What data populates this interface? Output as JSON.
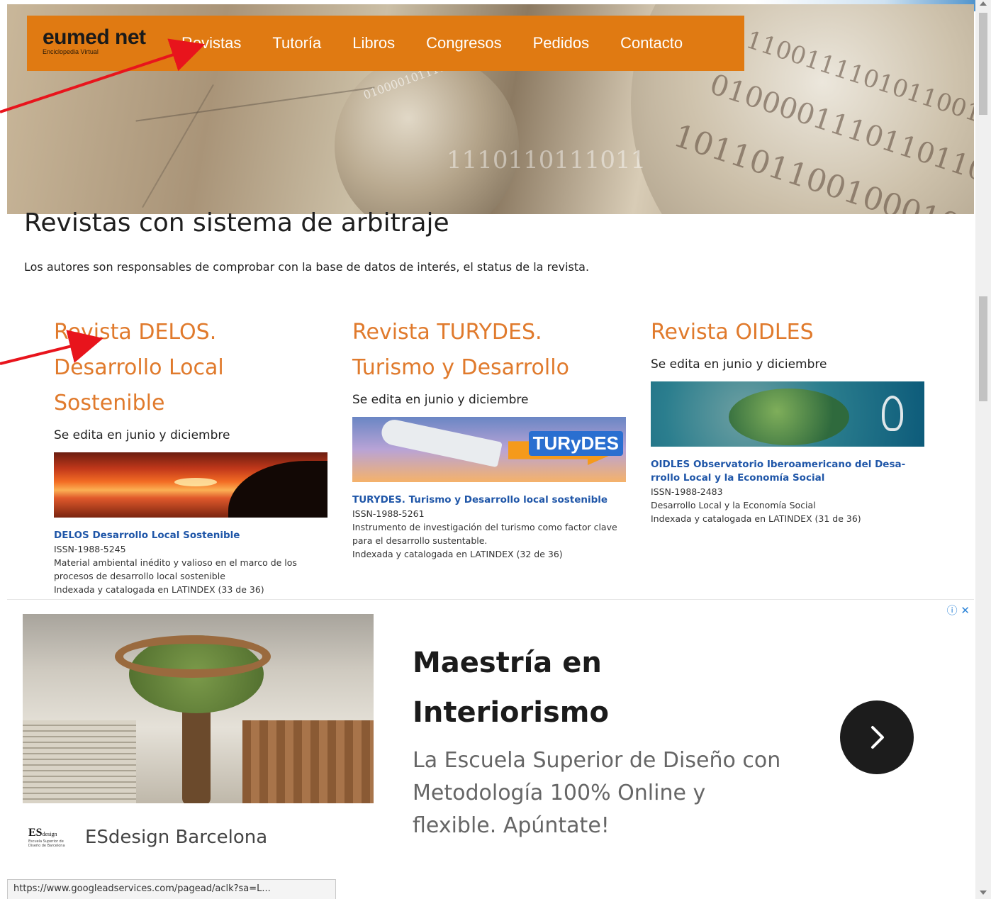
{
  "nav": {
    "logo_brand": "eumed net",
    "logo_tagline": "Enciclopedia Virtual",
    "items": [
      "Revistas",
      "Tutoría",
      "Libros",
      "Congresos",
      "Pedidos",
      "Contacto"
    ]
  },
  "main": {
    "title": "Revistas con sistema de arbitraje",
    "intro": "Los autores son responsables de comprobar con la base de datos de interés, el status de la revista.",
    "journals": [
      {
        "title": "Revista DELOS. Desarrollo Local Sostenible",
        "edition": "Se edita en junio y diciembre",
        "info_title": "DELOS Desarrollo Local Sostenible",
        "issn": "ISSN-1988-5245",
        "desc": "Material ambiental inédito y valioso en el marco de los procesos de desarrollo local sostenible",
        "index": "Indexada y catalogada en LATINDEX (33 de 36)"
      },
      {
        "title": "Revista TURYDES. Turismo y Desarrollo",
        "edition": "Se edita en junio y diciembre",
        "cover_brand": "TURyDES",
        "info_title": "TURYDES. Turismo y Desarrollo local sostenible",
        "issn": "ISSN-1988-5261",
        "desc": "Instrumento de investigación del turismo como factor clave para el desarrollo sustentable.",
        "index": "Indexada y catalogada en LATINDEX (32 de 36)"
      },
      {
        "title": "Revista OIDLES",
        "edition": "Se edita en junio y diciembre",
        "info_title": "OIDLES Observatorio Iberoamericano del Desa-rrollo Local y la Economía Social",
        "issn": "ISSN-1988-2483",
        "desc": "Desarrollo Local y la Economía Social",
        "index": "Indexada y catalogada en LATINDEX (31 de 36)"
      }
    ]
  },
  "ad": {
    "close_label": "ⓘ ✕",
    "logo_text": "ES",
    "logo_small": "design",
    "logo_sub": "Escuela Superior de Diseño de Barcelona",
    "advertiser": "ESdesign Barcelona",
    "headline": "Maestría en Interiorismo",
    "description": "La Escuela Superior de Diseño con Metodología 100% Online y flexible. Apúntate!",
    "cta_icon": "chevron-right-icon"
  },
  "status_bar": {
    "url": "https://www.googleadservices.com/pagead/aclk?sa=L..."
  },
  "colors": {
    "nav_bg": "#e07a12",
    "journal_title": "#e07a2c",
    "info_link": "#1f56a8",
    "annotation_arrow": "#e8141c"
  }
}
